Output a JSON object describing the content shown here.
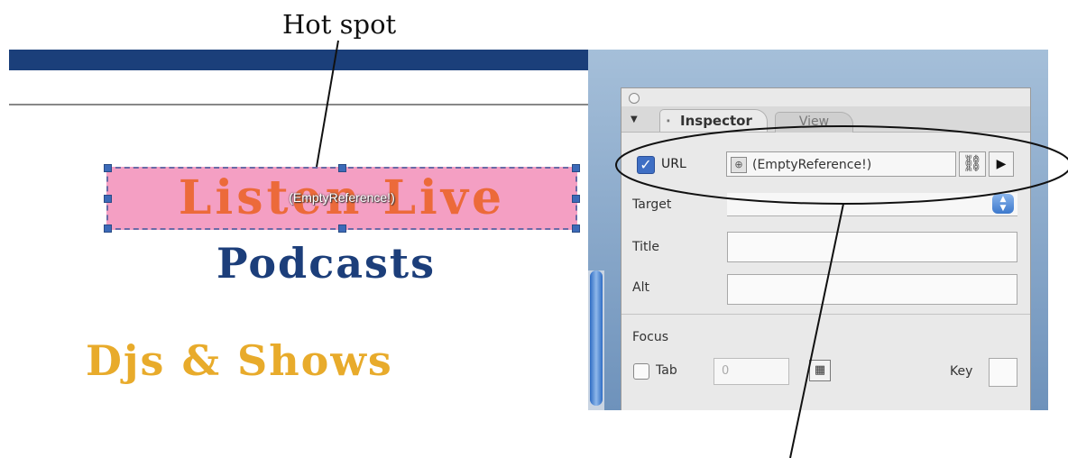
{
  "annotation": {
    "hotspot_caption": "Hot spot"
  },
  "canvas": {
    "hotspot_text": "Listen Live",
    "hotspot_label": "(EmptyReference!)",
    "menu_items": [
      "Podcasts",
      "Djs & Shows"
    ]
  },
  "inspector": {
    "tabs": [
      "Inspector",
      "View"
    ],
    "url": {
      "label": "URL",
      "checked": true,
      "value": "(EmptyReference!)"
    },
    "fields": [
      {
        "label": "Target",
        "value": ""
      },
      {
        "label": "Title",
        "value": ""
      },
      {
        "label": "Alt",
        "value": ""
      }
    ],
    "focus": {
      "section_label": "Focus",
      "tab_label": "Tab",
      "tab_value": "0",
      "key_label": "Key"
    }
  },
  "colors": {
    "header_bar": "#1b3f7a",
    "hotspot_fill": "#f49fc3",
    "listen_live": "#ec6a3a",
    "podcasts": "#1c3e7a",
    "djs_shows": "#e8ab2b"
  },
  "icons": [
    "globe-icon",
    "link-icon",
    "play-arrow-icon",
    "grid-icon",
    "checkmark-icon",
    "select-arrows-icon"
  ]
}
